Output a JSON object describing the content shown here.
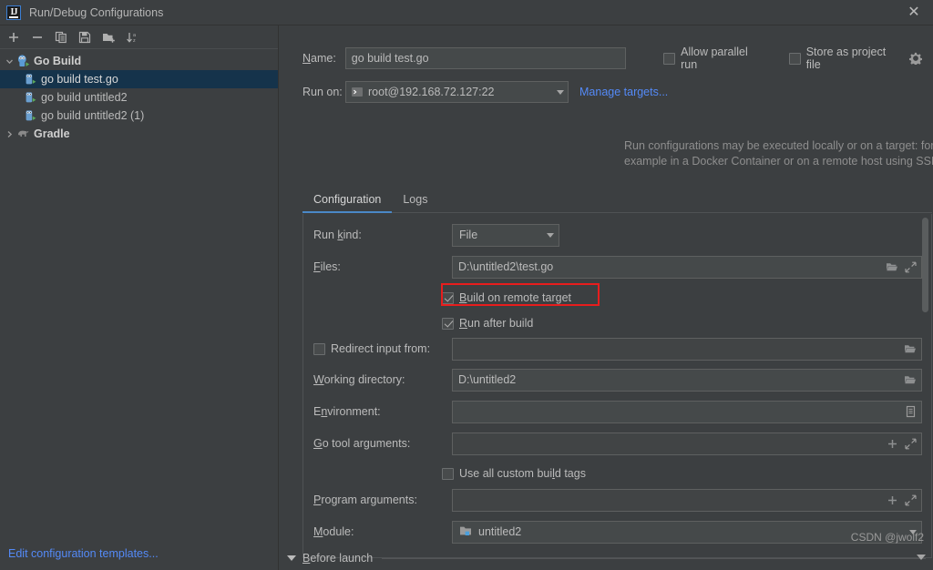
{
  "window": {
    "title": "Run/Debug Configurations",
    "logo_text": "IJ",
    "close_label": "✕"
  },
  "sidebar": {
    "toolbar": [
      {
        "name": "add",
        "tooltip": "Add New Configuration"
      },
      {
        "name": "remove",
        "tooltip": "Remove Configuration"
      },
      {
        "name": "copy",
        "tooltip": "Copy Configuration"
      },
      {
        "name": "save",
        "tooltip": "Save Configuration"
      },
      {
        "name": "move-into-folder",
        "tooltip": "Move into new folder"
      },
      {
        "name": "sort",
        "tooltip": "Sort Configurations"
      }
    ],
    "tree": [
      {
        "label": "Go Build",
        "type": "group",
        "expanded": true,
        "selected": false
      },
      {
        "label": "go build test.go",
        "type": "config",
        "selected": true
      },
      {
        "label": "go build untitled2",
        "type": "config",
        "selected": false
      },
      {
        "label": "go build untitled2 (1)",
        "type": "config",
        "selected": false
      },
      {
        "label": "Gradle",
        "type": "group",
        "expanded": false,
        "selected": false
      }
    ],
    "edit_templates_link": "Edit configuration templates..."
  },
  "header": {
    "name_label": "Name:",
    "name_value": "go build test.go",
    "allow_parallel_run": {
      "label": "Allow parallel run",
      "checked": false
    },
    "store_as_project_file": {
      "label": "Store as project file",
      "checked": false
    },
    "run_on_label": "Run on:",
    "run_on_value": "root@192.168.72.127:22",
    "manage_targets_link": "Manage targets...",
    "hint_line1": "Run configurations may be executed locally or on a target: for",
    "hint_line2": "example in a Docker Container or on a remote host using SSH."
  },
  "tabs": [
    {
      "label": "Configuration",
      "active": true
    },
    {
      "label": "Logs",
      "active": false
    }
  ],
  "form": {
    "run_kind_label": "Run kind:",
    "run_kind_value": "File",
    "files_label": "Files:",
    "files_value": "D:\\untitled2\\test.go",
    "build_on_remote_target": {
      "label": "Build on remote target",
      "checked": true,
      "highlighted": true
    },
    "run_after_build": {
      "label": "Run after build",
      "checked": true
    },
    "redirect_input_from": {
      "label": "Redirect input from:",
      "checked": false,
      "value": ""
    },
    "working_directory_label": "Working directory:",
    "working_directory_value": "D:\\untitled2",
    "environment_label": "Environment:",
    "environment_value": "",
    "go_tool_arguments_label": "Go tool arguments:",
    "go_tool_arguments_value": "",
    "use_all_custom_build_tags": {
      "label": "Use all custom build tags",
      "checked": false
    },
    "program_arguments_label": "Program arguments:",
    "program_arguments_value": "",
    "module_label": "Module:",
    "module_value": "untitled2"
  },
  "footer": {
    "before_launch_label": "Before launch",
    "watermark": "CSDN @jwolf2"
  },
  "colors": {
    "background": "#3c3f41",
    "selection": "#15334b",
    "link": "#548af7",
    "accent": "#4a88c7",
    "highlight": "#e81d1d",
    "field": "#45494a"
  }
}
